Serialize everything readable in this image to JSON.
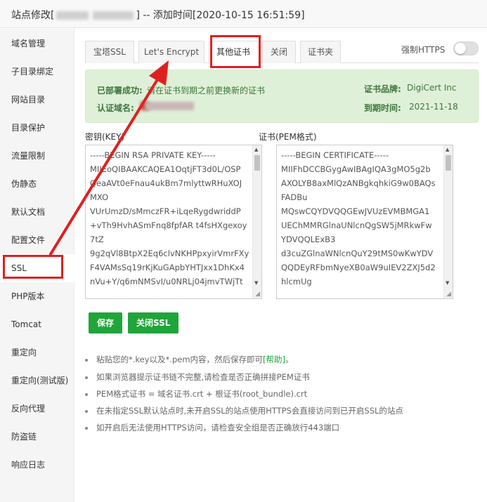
{
  "window": {
    "title_prefix": "站点修改[",
    "title_suffix": "] -- 添加时间[2020-10-15 16:51:59]"
  },
  "sidebar": {
    "items": [
      {
        "label": "域名管理"
      },
      {
        "label": "子目录绑定"
      },
      {
        "label": "网站目录"
      },
      {
        "label": "目录保护"
      },
      {
        "label": "流量限制"
      },
      {
        "label": "伪静态"
      },
      {
        "label": "默认文档"
      },
      {
        "label": "配置文件"
      },
      {
        "label": "SSL",
        "active": true
      },
      {
        "label": "PHP版本"
      },
      {
        "label": "Tomcat"
      },
      {
        "label": "重定向"
      },
      {
        "label": "重定向(测试版)"
      },
      {
        "label": "反向代理"
      },
      {
        "label": "防盗链"
      },
      {
        "label": "响应日志"
      }
    ]
  },
  "tabs": [
    {
      "label": "宝塔SSL"
    },
    {
      "label": "Let's Encrypt"
    },
    {
      "label": "其他证书",
      "active": true
    },
    {
      "label": "关闭"
    },
    {
      "label": "证书夹"
    }
  ],
  "force_https": {
    "label": "强制HTTPS",
    "enabled": false
  },
  "cert_info": {
    "deployed_label": "已部署成功:",
    "deployed_text": "请在证书到期之前更换新的证书",
    "domain_label": "认证域名:",
    "brand_label": "证书品牌:",
    "brand_value": "DigiCert Inc",
    "expire_label": "到期时间:",
    "expire_value": "2021-11-18"
  },
  "key_field": {
    "label": "密钥(KEY)",
    "value": "-----BEGIN RSA PRIVATE KEY-----\nMIIEoQIBAAKCAQEA1OqtjFT3d0L/OSP\nQeaAVt0eFnau4ukBm7mlyttwRHuXOJ\nMXO\nVUrUmzD/sMmczFR+iLqeRygdwriddP\n+vTh9HvhASmFnq8fpfAR t4fsHXgexoy\n7tZ\n9g2qVl8BtpX2Eq6clvNKHPpxyirVmrFXy\nF4VAMsSq19rKjKuGApbYHTJxx1DhKx4\nnVu+Y/q6mNMSvI/u0NRLj04jmvTWjTt"
  },
  "cert_field": {
    "label": "证书(PEM格式)",
    "value": "-----BEGIN CERTIFICATE-----\nMIIFhDCCBGygAwIBAgIQA3gMO5g2b\nAXOLYB8axMlQzANBgkqhkiG9w0BAQs\nFADBu\nMQswCQYDVQQGEwJVUzEVMBMGA1\nUEChMMRGlnaUNlcnQgSW5jMRkwFw\nYDVQQLExB3\nd3cuZGlnaWNlcnQuY29tMS0wKwYDV\nQQDEyRFbmNyeXB0aW9uIEV2ZXJ5d2\nhlcmUg"
  },
  "buttons": {
    "save": "保存",
    "close_ssl": "关闭SSL"
  },
  "tips": [
    {
      "text": "粘贴您的*.key以及*.pem内容，然后保存即可",
      "help": "[帮助]",
      "tail": "。"
    },
    {
      "text": "如果浏览器提示证书链不完整,请检查是否正确拼接PEM证书"
    },
    {
      "text": "PEM格式证书 = 域名证书.crt + 根证书(root_bundle).crt"
    },
    {
      "text": "在未指定SSL默认站点时,未开启SSL的站点使用HTTPS会直接访问到已开启SSL的站点"
    },
    {
      "text": "如开启后无法使用HTTPS访问，请检查安全组是否正确放行443端口"
    }
  ],
  "colors": {
    "accent": "#20a53a",
    "annotation": "#e02020",
    "success_bg": "#dff0d8",
    "success_text": "#3c763d"
  }
}
